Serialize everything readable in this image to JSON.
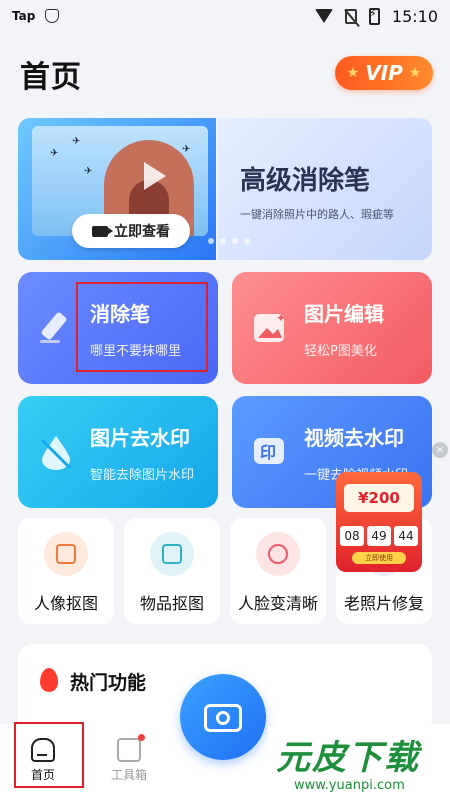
{
  "status_bar": {
    "app": "Tap",
    "time": "15:10"
  },
  "header": {
    "title": "首页",
    "vip_label": "VIP"
  },
  "banner": {
    "button_label": "立即查看",
    "headline": "高级消除笔",
    "subline": "一键消除照片中的路人、瑕疵等"
  },
  "features": [
    {
      "name": "消除笔",
      "desc": "哪里不要抹哪里"
    },
    {
      "name": "图片编辑",
      "desc": "轻松P图美化"
    },
    {
      "name": "图片去水印",
      "desc": "智能去除图片水印"
    },
    {
      "name": "视频去水印",
      "desc": "一键去除视频水印"
    }
  ],
  "tools": [
    {
      "label": "人像抠图"
    },
    {
      "label": "物品抠图"
    },
    {
      "label": "人脸变清晰"
    },
    {
      "label": "老照片修复"
    }
  ],
  "hot": {
    "title": "热门功能"
  },
  "promo": {
    "amount": "¥200",
    "hours": "08",
    "minutes": "49",
    "seconds": "44",
    "use_label": "立即使用",
    "close": "×"
  },
  "tabbar": {
    "home_label": "首页",
    "tools_label": "工具箱"
  },
  "watermark": {
    "brand": "元皮下载",
    "url": "www.yuanpi.com"
  }
}
